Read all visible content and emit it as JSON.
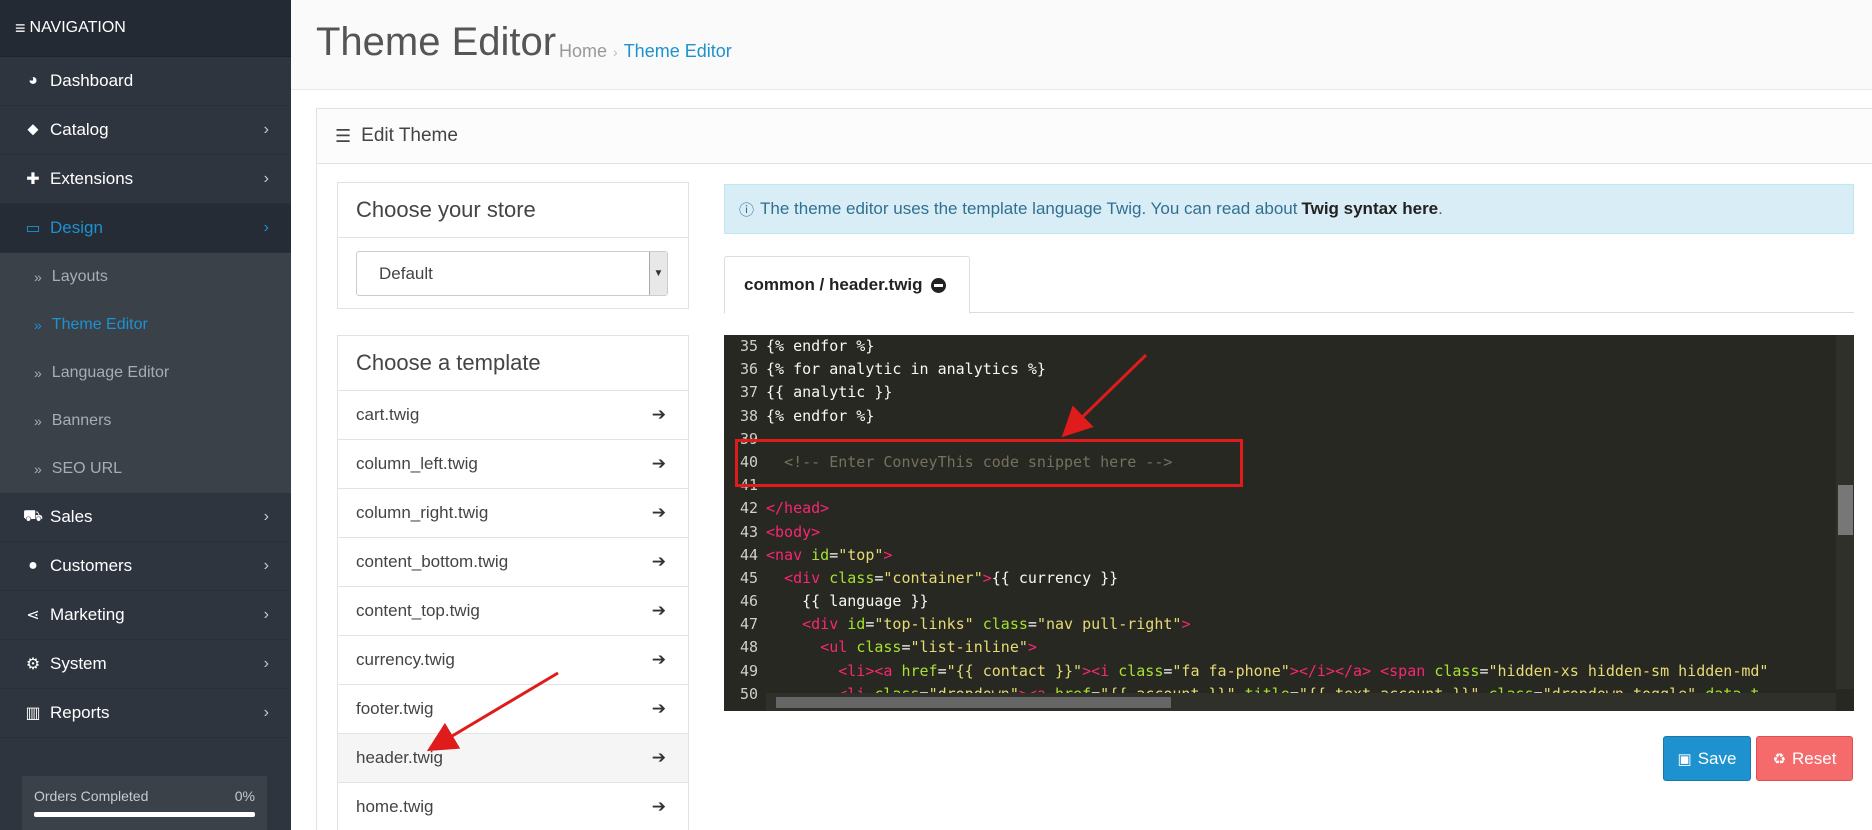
{
  "sidebar": {
    "header": "NAVIGATION",
    "items": [
      {
        "label": "Dashboard",
        "icon": "dashboard-icon",
        "glyph": "◕"
      },
      {
        "label": "Catalog",
        "icon": "tag-icon",
        "glyph": "⬥"
      },
      {
        "label": "Extensions",
        "icon": "puzzle-icon",
        "glyph": "✚"
      },
      {
        "label": "Design",
        "icon": "monitor-icon",
        "glyph": "▭"
      }
    ],
    "design_sub": [
      "Layouts",
      "Theme Editor",
      "Language Editor",
      "Banners",
      "SEO URL"
    ],
    "items_after": [
      {
        "label": "Sales",
        "icon": "cart-icon",
        "glyph": "⛟"
      },
      {
        "label": "Customers",
        "icon": "user-icon",
        "glyph": "●"
      },
      {
        "label": "Marketing",
        "icon": "share-icon",
        "glyph": "⋖"
      },
      {
        "label": "System",
        "icon": "gear-icon",
        "glyph": "⚙"
      },
      {
        "label": "Reports",
        "icon": "bar-chart-icon",
        "glyph": "▥"
      }
    ],
    "progress": {
      "label": "Orders Completed",
      "value": "0%"
    }
  },
  "header": {
    "title": "Theme Editor",
    "breadcrumb_home": "Home",
    "breadcrumb_current": "Theme Editor"
  },
  "panel": {
    "heading": "Edit Theme"
  },
  "store": {
    "title": "Choose your store",
    "selected": "Default"
  },
  "templates": {
    "title": "Choose a template",
    "items": [
      "cart.twig",
      "column_left.twig",
      "column_right.twig",
      "content_bottom.twig",
      "content_top.twig",
      "currency.twig",
      "footer.twig",
      "header.twig",
      "home.twig"
    ]
  },
  "alert": {
    "text": "The theme editor uses the template language Twig. You can read about",
    "link": "Twig syntax here",
    "end": "."
  },
  "tab": {
    "label": "common / header.twig"
  },
  "code": [
    {
      "n": "35",
      "html": "{% endfor %}"
    },
    {
      "n": "36",
      "html": "{% for analytic in analytics %}"
    },
    {
      "n": "37",
      "html": "{{ analytic }}"
    },
    {
      "n": "38",
      "html": "{% endfor %}"
    },
    {
      "n": "39",
      "html": ""
    },
    {
      "n": "40",
      "html": "  <span class=\"cmt\">&lt;!-- Enter ConveyThis code snippet here --&gt;</span>"
    },
    {
      "n": "41",
      "html": ""
    },
    {
      "n": "42",
      "html": "<span class=\"tag\">&lt;/head&gt;</span>"
    },
    {
      "n": "43",
      "html": "<span class=\"tag\">&lt;body&gt;</span>"
    },
    {
      "n": "44",
      "html": "<span class=\"tag\">&lt;nav</span> <span class=\"attr\">id</span>=<span class=\"str\">\"top\"</span><span class=\"tag\">&gt;</span>"
    },
    {
      "n": "45",
      "html": "  <span class=\"tag\">&lt;div</span> <span class=\"attr\">class</span>=<span class=\"str\">\"container\"</span><span class=\"tag\">&gt;</span>{{ currency }}"
    },
    {
      "n": "46",
      "html": "    {{ language }}"
    },
    {
      "n": "47",
      "html": "    <span class=\"tag\">&lt;div</span> <span class=\"attr\">id</span>=<span class=\"str\">\"top-links\"</span> <span class=\"attr\">class</span>=<span class=\"str\">\"nav pull-right\"</span><span class=\"tag\">&gt;</span>"
    },
    {
      "n": "48",
      "html": "      <span class=\"tag\">&lt;ul</span> <span class=\"attr\">class</span>=<span class=\"str\">\"list-inline\"</span><span class=\"tag\">&gt;</span>"
    },
    {
      "n": "49",
      "html": "        <span class=\"tag\">&lt;li&gt;&lt;a</span> <span class=\"attr\">href</span>=<span class=\"str\">\"{{ contact }}\"</span><span class=\"tag\">&gt;&lt;i</span> <span class=\"attr\">class</span>=<span class=\"str\">\"fa fa-phone\"</span><span class=\"tag\">&gt;&lt;/i&gt;&lt;/a&gt;</span> <span class=\"tag\">&lt;span</span> <span class=\"attr\">class</span>=<span class=\"str\">\"hidden-xs hidden-sm hidden-md\"</span>"
    },
    {
      "n": "50",
      "html": "        <span class=\"tag\">&lt;li</span> <span class=\"attr\">class</span>=<span class=\"str\">\"dropdown\"</span><span class=\"tag\">&gt;&lt;a</span> <span class=\"attr\">href</span>=<span class=\"str\">\"{{ account }}\"</span> <span class=\"attr\">title</span>=<span class=\"str\">\"{{ text_account }}\"</span> <span class=\"attr\">class</span>=<span class=\"str\">\"dropdown-toggle\"</span> <span class=\"attr\">data-t</span>"
    }
  ],
  "buttons": {
    "save": "Save",
    "reset": "Reset"
  },
  "colors": {
    "accent": "#1e91cf",
    "sidebar": "#2e353f",
    "danger": "#f56b6b",
    "annotation": "#e01b1b"
  }
}
